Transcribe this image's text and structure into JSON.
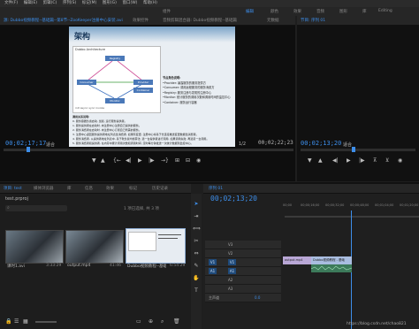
{
  "menu": [
    "文件(F)",
    "编辑(E)",
    "剪辑(C)",
    "序列(S)",
    "标记(M)",
    "图形(G)",
    "窗口(W)",
    "帮助(H)"
  ],
  "workspaces": [
    "组件",
    "编辑",
    "颜色",
    "效果",
    "音频",
    "图形",
    "库",
    "Editing"
  ],
  "source_tabs": [
    "源: Dubbo视频教程--基础篇--第8节--ZooKeeper注册中心安装.avi",
    "效果控件",
    "音频剪辑混合器: Dubbo视频教程--基础篇",
    "元数据"
  ],
  "program_tab": "节目: 序列 01",
  "source_monitor": {
    "timecode_left": "00;02;17;17",
    "fit": "适合",
    "timecode_right": "00;02;22;23",
    "page": "1/2"
  },
  "program_monitor": {
    "timecode_left": "00;02;13;20",
    "fit": "适合"
  },
  "slide": {
    "title": "架构",
    "diagram_title": "Dubbo Architecture",
    "diagram_nodes": [
      "Registry",
      "Consumer",
      "Provider",
      "Container",
      "Monitor"
    ],
    "legend": [
      "init",
      "async",
      "sync",
      "invoke"
    ],
    "roles_title": "节点角色说明:",
    "roles": [
      "•Provider: 暴露服务的服务提供方",
      "•Consumer: 调用远程服务的服务消费方",
      "•Registry: 服务注册与发现的注册中心",
      "•Monitor: 统计服务的调用次数和调用时间的监控中心",
      "•Container: 服务运行容器"
    ],
    "call_title": "调用关系说明:",
    "calls": [
      "0. 服务容器负责启动, 加载, 运行服务提供者。",
      "1. 服务提供者在启动时, 向注册中心注册自己提供的服务。",
      "2. 服务消费者在启动时, 向注册中心订阅自己所需的服务。",
      "3. 注册中心返回服务提供者地址列表给消费者, 如果有变更, 注册中心将基于长连接推送变更数据给消费者。",
      "4. 服务消费者, 从提供者地址列表中, 基于软负载均衡算法, 选一台提供者进行调用, 如果调用失败, 再选另一台调用。",
      "5. 服务消费者和提供者, 在内存中累计调用次数和调用时间, 定时每分钟发送一次统计数据到监控中心。"
    ]
  },
  "project_tabs": [
    "项目: test",
    "媒体浏览器",
    "库",
    "信息",
    "效果",
    "标记",
    "历史记录"
  ],
  "project": {
    "name": "test.prproj",
    "count": "1 项已选择, 共 3 项",
    "items": [
      {
        "name": "课时1.avi",
        "dur": "3:33:29"
      },
      {
        "name": "output.mp4",
        "dur": "41:46"
      },
      {
        "name": "Dubbo视频教程--基础篇--第8节...",
        "dur": "6:54:29"
      }
    ]
  },
  "timeline": {
    "tab": "序列 01",
    "timecode": "00;02;13;20",
    "ruler": [
      "00;00",
      "00;00;16;00",
      "00;00;32;00",
      "00;00;48;00",
      "00;01;04;00",
      "00;01;20;00",
      "00;01;36;00",
      "00;01;52;00"
    ],
    "video_tracks": [
      "V3",
      "V2",
      "V1"
    ],
    "audio_tracks": [
      "A1",
      "A2",
      "A3"
    ],
    "clips": [
      {
        "label": "output.mp4"
      },
      {
        "label": "Dubbo视频教程 - 基础"
      }
    ],
    "master": "主声道",
    "master_val": "0.0"
  },
  "watermark": "https://blog.csdn.net/chao821"
}
